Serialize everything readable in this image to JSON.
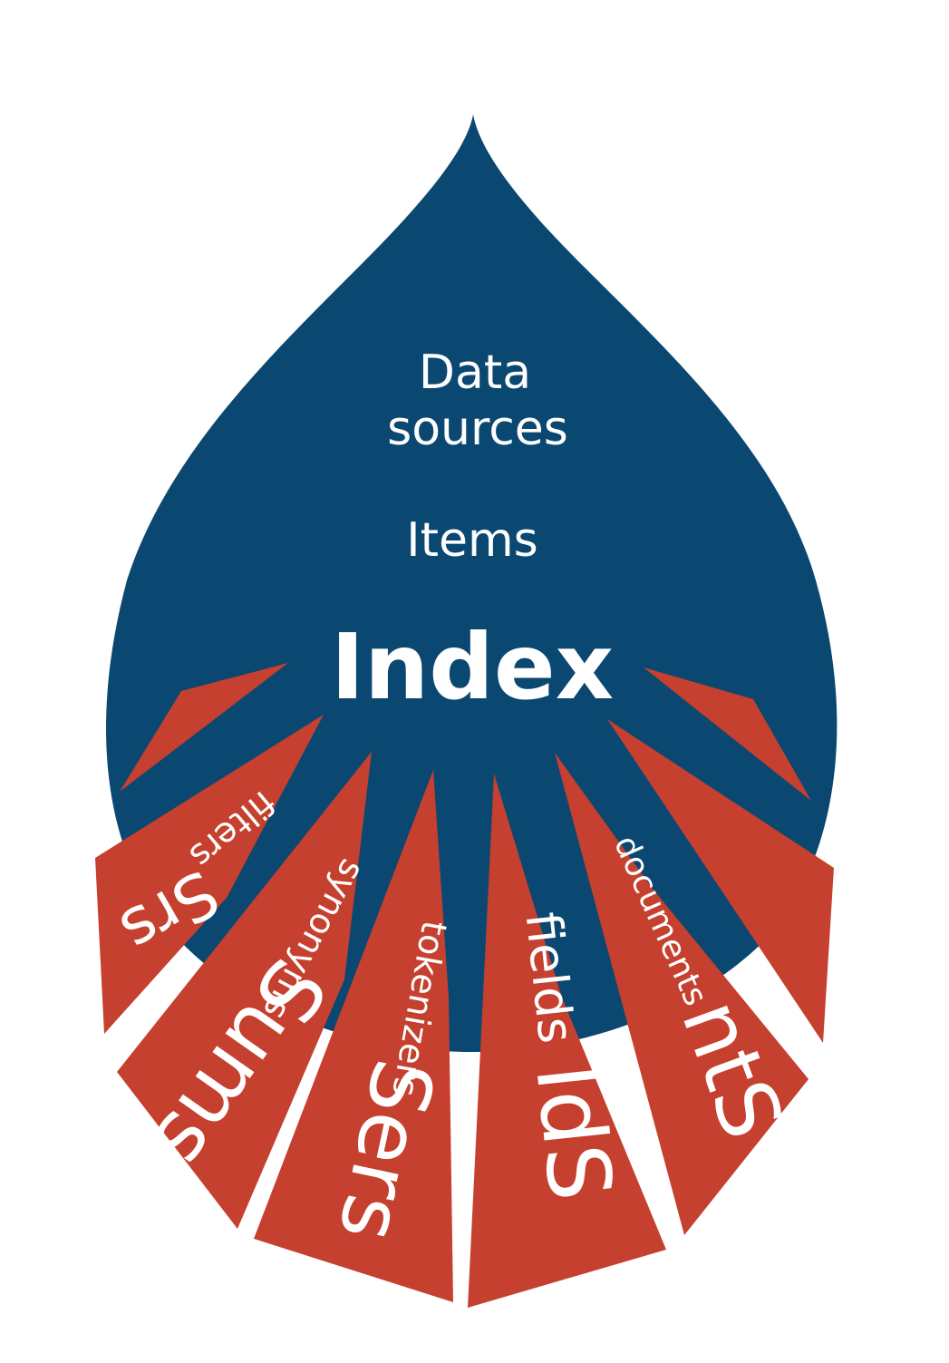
{
  "colors": {
    "drop": "#0a4771",
    "rays": "#c5402e",
    "text": "#ffffff",
    "background": "#ffffff"
  },
  "labels": {
    "data": "Data",
    "sources": "sources",
    "items": "Items",
    "index": "Index"
  },
  "rays": [
    {
      "small": "filters",
      "large": "Srs"
    },
    {
      "small": "synonyms",
      "large": "Sums"
    },
    {
      "small": "tokenizers",
      "large": "Sers"
    },
    {
      "small": "fields",
      "large": "IdS"
    },
    {
      "small": "documents",
      "large": "ntS"
    }
  ]
}
